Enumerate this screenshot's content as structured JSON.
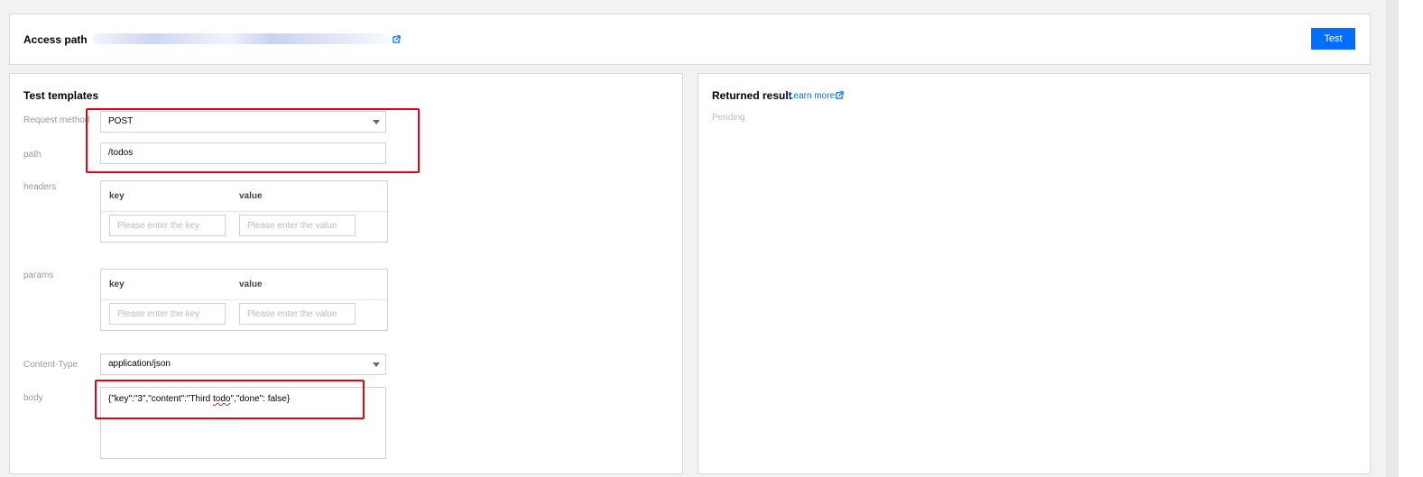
{
  "access": {
    "title": "Access path",
    "test_label": "Test"
  },
  "templates": {
    "title": "Test templates",
    "request_method": {
      "label": "Request method",
      "value": "POST"
    },
    "path": {
      "label": "path",
      "value": "/todos"
    },
    "headers": {
      "label": "headers",
      "key_header": "key",
      "value_header": "value",
      "key_placeholder": "Please enter the key",
      "value_placeholder": "Please enter the value"
    },
    "params": {
      "label": "params",
      "key_header": "key",
      "value_header": "value",
      "key_placeholder": "Please enter the key",
      "value_placeholder": "Please enter the value"
    },
    "content_type": {
      "label": "Content-Type",
      "value": "application/json"
    },
    "body": {
      "label": "body",
      "value_before": "{\"key\":\"3\",\"content\":\"Third ",
      "value_misspelled": "todo",
      "value_after": "\",\"done\": false}"
    }
  },
  "result": {
    "title": "Returned result",
    "learn_more": "Learn more",
    "status": "Pending"
  },
  "colors": {
    "accent": "#006eff",
    "highlight_box": "#e60012"
  },
  "icons": {
    "external_link": "external-link-icon",
    "dropdown": "chevron-down-icon"
  }
}
